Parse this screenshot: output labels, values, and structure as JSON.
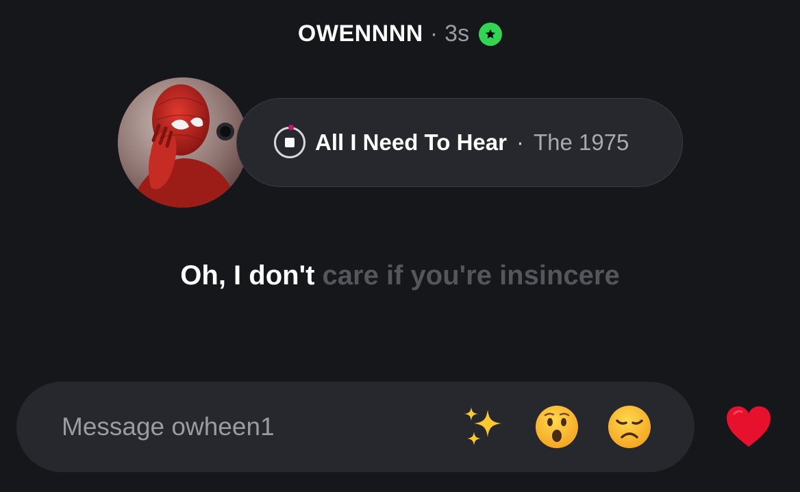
{
  "header": {
    "username": "OWENNNN",
    "separator": "·",
    "time": "3s",
    "badge_icon": "green-star-badge",
    "badge_color": "#33d452"
  },
  "note": {
    "song_title": "All I Need To Hear",
    "separator": "·",
    "artist": "The 1975",
    "playback_icon": "stop-icon"
  },
  "lyric": {
    "sung": "Oh, I don't",
    "unsung": "care if you're insincere"
  },
  "composer": {
    "placeholder": "Message owheen1",
    "quick_reactions": [
      "sparkles-emoji",
      "hushed-face-emoji",
      "disappointed-face-emoji"
    ],
    "like_icon": "heart-icon",
    "heart_color": "#e8112d"
  },
  "colors": {
    "background": "#16171b",
    "bubble": "#26282d",
    "muted_text": "#9a9ca3",
    "unsung_lyric": "#54565c"
  }
}
